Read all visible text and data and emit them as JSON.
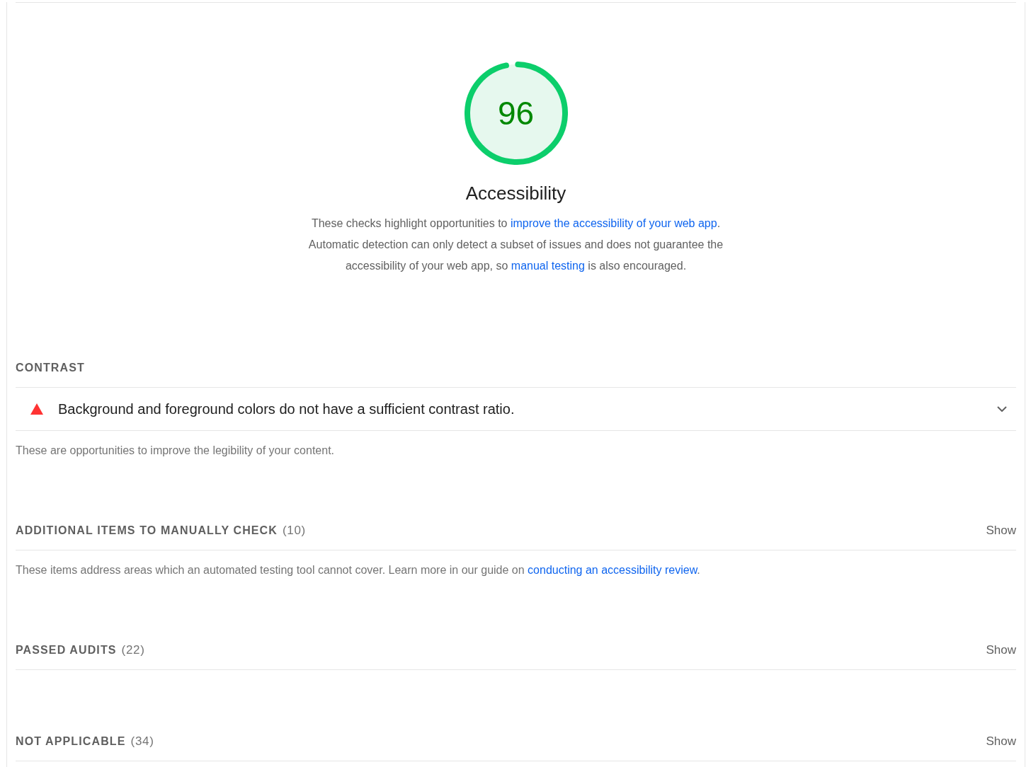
{
  "gauge": {
    "score": "96",
    "level": 0.96
  },
  "category": {
    "title": "Accessibility",
    "description": [
      {
        "kind": "text",
        "text": "These checks highlight opportunities to "
      },
      {
        "kind": "link",
        "text": "improve the accessibility of your web app"
      },
      {
        "kind": "text",
        "text": ". Automatic detection can only detect a subset of issues and does not guarantee the accessibility of your web app, so "
      },
      {
        "kind": "link",
        "text": "manual testing"
      },
      {
        "kind": "text",
        "text": " is also encouraged."
      }
    ]
  },
  "groups": [
    {
      "title": "CONTRAST",
      "audits": [
        {
          "kind": "fail",
          "title": "Background and foreground colors do not have a sufficient contrast ratio.",
          "expanded": false
        }
      ],
      "description": [
        {
          "kind": "text",
          "text": "These are opportunities to improve the legibility of your content."
        }
      ]
    },
    {
      "title": "ADDITIONAL ITEMS TO MANUALLY CHECK",
      "count": "(10)",
      "toggle": "Show",
      "description": [
        {
          "kind": "text",
          "text": "These items address areas which an automated testing tool cannot cover. Learn more in our guide on "
        },
        {
          "kind": "link",
          "text": "conducting an accessibility review"
        },
        {
          "kind": "text",
          "text": "."
        }
      ]
    },
    {
      "title": "PASSED AUDITS",
      "count": "(22)",
      "toggle": "Show"
    },
    {
      "title": "NOT APPLICABLE",
      "count": "(34)",
      "toggle": "Show"
    }
  ]
}
